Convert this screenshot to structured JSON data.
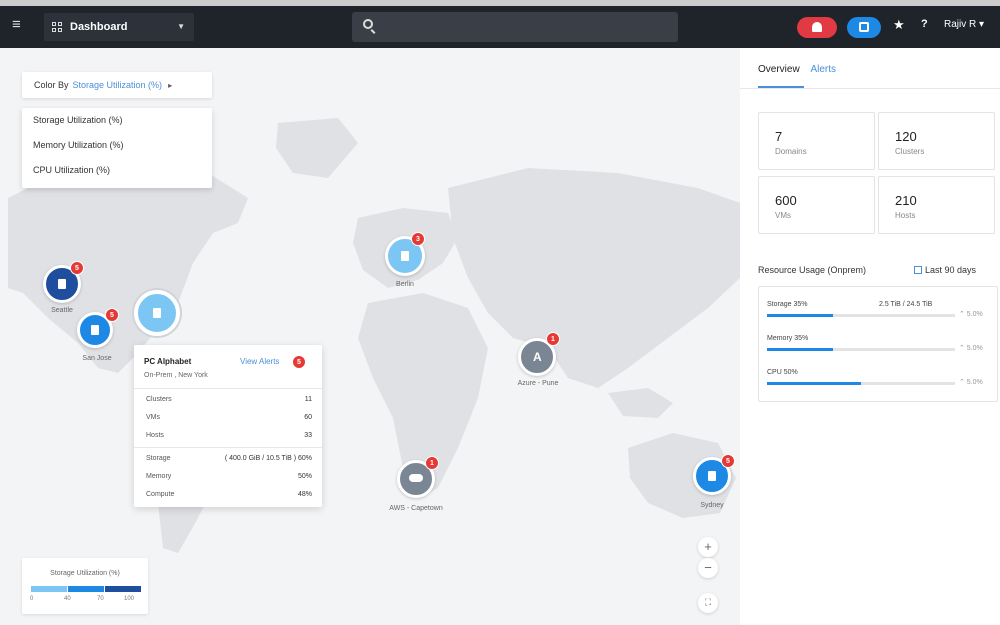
{
  "topbar": {
    "app_selector": "Dashboard",
    "user": "Rajiv R",
    "help": "?",
    "star": "★"
  },
  "map": {
    "color_by": {
      "label": "Color By",
      "value": "Storage Utilization (%)",
      "options": [
        "Storage Utilization (%)",
        "Memory Utilization (%)",
        "CPU Utilization (%)"
      ]
    },
    "sites": [
      {
        "name": "Seattle",
        "alerts": "5",
        "color": "#1f4e9e"
      },
      {
        "name": "San Jose",
        "alerts": "5",
        "color": "#1e88e5"
      },
      {
        "name": "Berlin",
        "alerts": "3",
        "color": "#7cc6f3"
      },
      {
        "name": "Azure - Pune",
        "alerts": "1",
        "color": "#7b8694"
      },
      {
        "name": "AWS - Capetown",
        "alerts": "1",
        "color": "#7b8694"
      },
      {
        "name": "Sydney",
        "alerts": "5",
        "color": "#1e88e5"
      }
    ],
    "selected_site": {
      "color": "#7cc6f3"
    },
    "popup": {
      "title": "PC Alphabet",
      "subtitle": "On-Prem , New York",
      "view_alerts": "View Alerts",
      "alerts": "5",
      "rows": [
        {
          "label": "Clusters",
          "value": "11"
        },
        {
          "label": "VMs",
          "value": "60"
        },
        {
          "label": "Hosts",
          "value": "33"
        }
      ],
      "util_rows": [
        {
          "label": "Storage",
          "value": "( 400.0 GiB / 10.5 TiB ) 60%"
        },
        {
          "label": "Memory",
          "value": "50%"
        },
        {
          "label": "Compute",
          "value": "48%"
        }
      ]
    },
    "legend": {
      "title": "Storage Utilization (%)",
      "ticks": [
        "0",
        "40",
        "70",
        "100"
      ],
      "colors": [
        "#7cc6f3",
        "#1e88e5",
        "#1f4e9e"
      ]
    },
    "zoom_in": "+",
    "zoom_out": "−"
  },
  "panel": {
    "tabs": [
      "Overview",
      "Alerts"
    ],
    "stats": [
      {
        "value": "7",
        "label": "Domains"
      },
      {
        "value": "120",
        "label": "Clusters"
      },
      {
        "value": "600",
        "label": "VMs"
      },
      {
        "value": "210",
        "label": "Hosts"
      }
    ],
    "resource_usage": {
      "title": "Resource Usage (Onprem)",
      "range": "Last 90 days",
      "items": [
        {
          "name": "Storage 35%",
          "amount": "2.5 TiB / 24.5 TiB",
          "percent": 35,
          "trend": "⌃ 5.0%"
        },
        {
          "name": "Memory 35%",
          "amount": "",
          "percent": 35,
          "trend": "⌃ 5.0%"
        },
        {
          "name": "CPU 50%",
          "amount": "",
          "percent": 50,
          "trend": "⌃ 5.0%"
        }
      ]
    }
  },
  "colors": {
    "topbar": "#1f232a",
    "accent": "#4a90d9",
    "alert": "#e53935"
  }
}
